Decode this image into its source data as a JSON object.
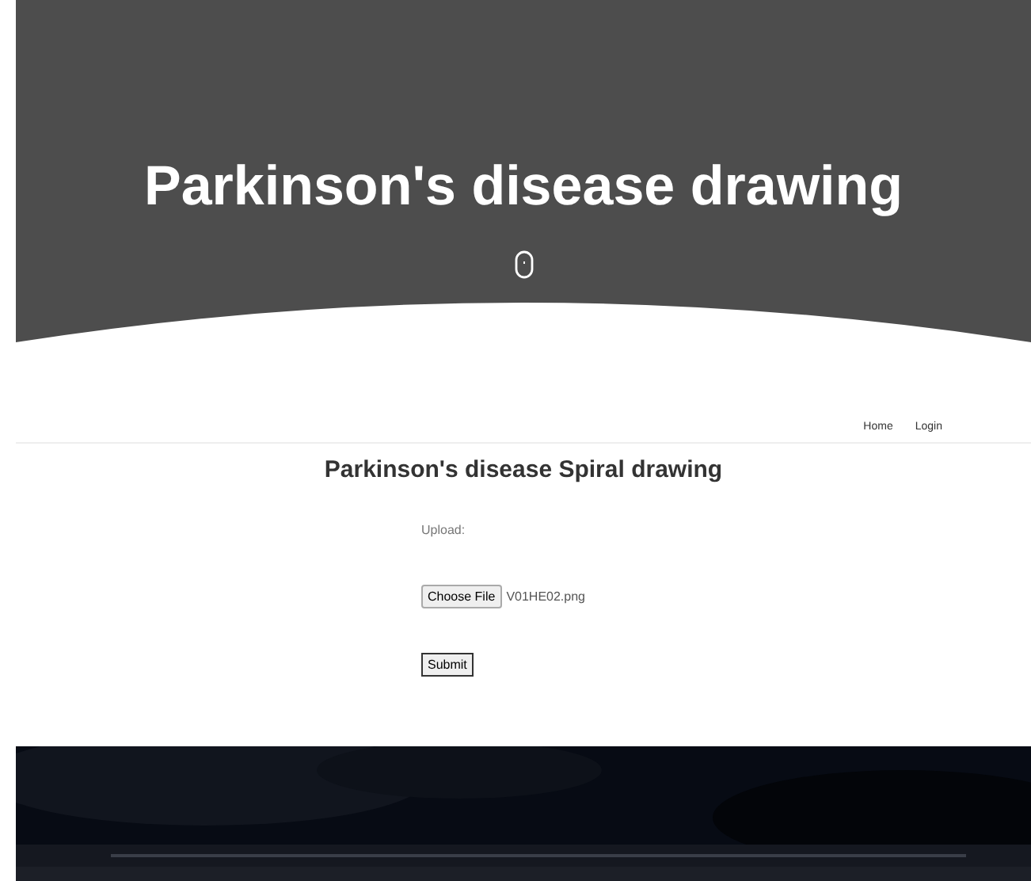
{
  "hero": {
    "title": "Parkinson's disease drawing"
  },
  "nav": {
    "links": [
      "Home",
      "Login"
    ]
  },
  "form": {
    "heading": "Parkinson's disease Spiral drawing",
    "upload_label": "Upload:",
    "file_button": "Choose File",
    "file_name": "V01HE02.png",
    "submit": "Submit"
  }
}
